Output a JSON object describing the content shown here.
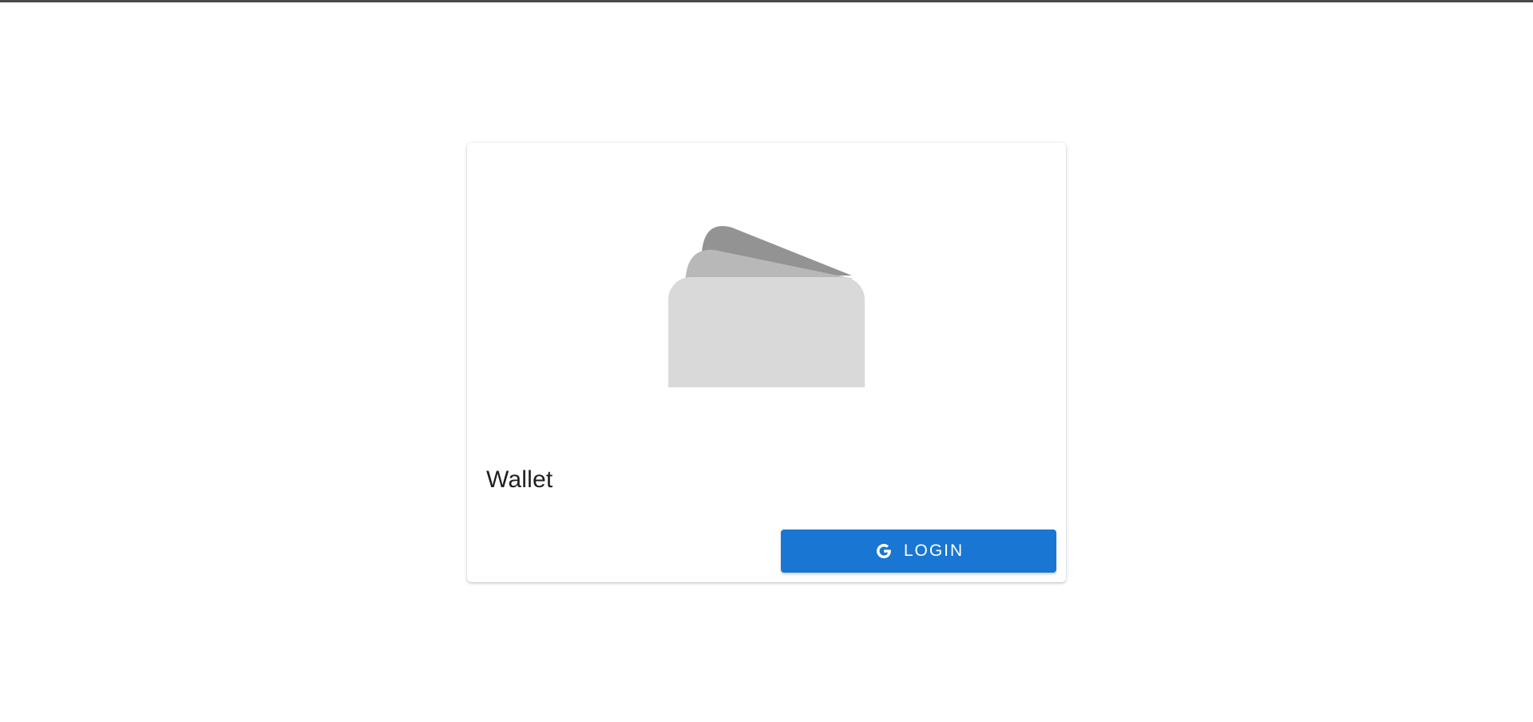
{
  "card": {
    "image_icon": "wallet-cards-icon",
    "title": "Wallet"
  },
  "login": {
    "label": "LOGIN",
    "icon": "google-g-icon",
    "color": "#1976d2"
  }
}
